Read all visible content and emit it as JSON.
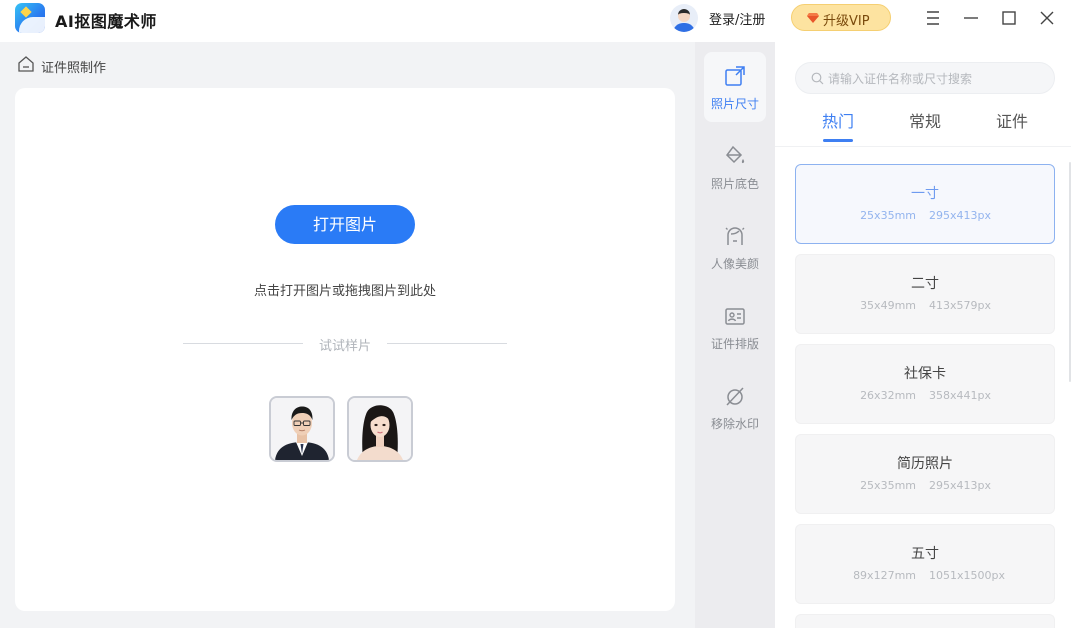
{
  "app": {
    "title": "AI抠图魔术师"
  },
  "header": {
    "login_label": "登录/注册",
    "vip_label": "升级VIP",
    "accent_color": "#2a7bf6",
    "vip_color": "#fde3a0"
  },
  "window_controls": [
    "menu-icon",
    "minimize-icon",
    "maximize-icon",
    "close-icon"
  ],
  "breadcrumb": {
    "label": "证件照制作",
    "icon": "home-icon"
  },
  "main": {
    "open_button": "打开图片",
    "hint": "点击打开图片或拖拽图片到此处",
    "samples_title": "试试样片",
    "samples": [
      {
        "name": "sample-photo-man"
      },
      {
        "name": "sample-photo-woman"
      }
    ]
  },
  "toolbar": {
    "items": [
      {
        "label": "照片尺寸",
        "icon": "photo-size-icon",
        "active": true
      },
      {
        "label": "照片底色",
        "icon": "paint-bucket-icon",
        "active": false
      },
      {
        "label": "人像美颜",
        "icon": "face-beauty-icon",
        "active": false
      },
      {
        "label": "证件排版",
        "icon": "id-card-icon",
        "active": false
      },
      {
        "label": "移除水印",
        "icon": "remove-watermark-icon",
        "active": false
      }
    ]
  },
  "right_panel": {
    "search_placeholder": "请输入证件名称或尺寸搜索",
    "tabs": [
      {
        "label": "热门",
        "active": true
      },
      {
        "label": "常规",
        "active": false
      },
      {
        "label": "证件",
        "active": false
      }
    ],
    "specs": [
      {
        "name": "一寸",
        "mm": "25x35mm",
        "px": "295x413px",
        "selected": true
      },
      {
        "name": "二寸",
        "mm": "35x49mm",
        "px": "413x579px",
        "selected": false
      },
      {
        "name": "社保卡",
        "mm": "26x32mm",
        "px": "358x441px",
        "selected": false
      },
      {
        "name": "简历照片",
        "mm": "25x35mm",
        "px": "295x413px",
        "selected": false
      },
      {
        "name": "五寸",
        "mm": "89x127mm",
        "px": "1051x1500px",
        "selected": false
      }
    ]
  }
}
